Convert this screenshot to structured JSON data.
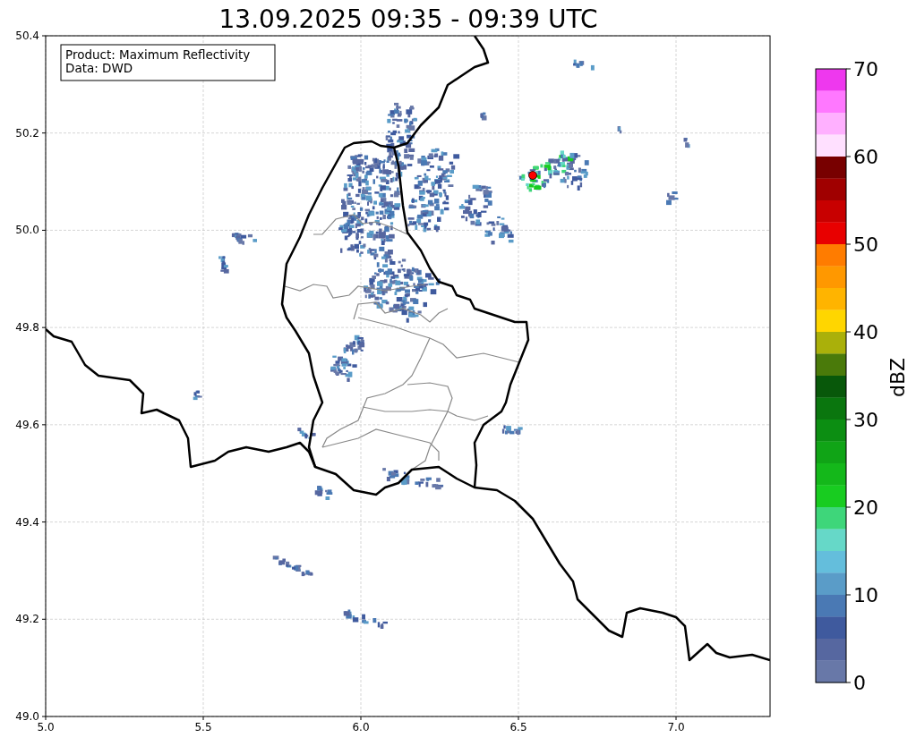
{
  "title": "13.09.2025 09:35 - 09:39 UTC",
  "info_box": [
    "Product: Maximum Reflectivity",
    "Data: DWD"
  ],
  "x_axis": {
    "ticks": [
      "5.0",
      "5.5",
      "6.0",
      "6.5",
      "7.0"
    ]
  },
  "y_axis": {
    "ticks": [
      "50.4",
      "50.2",
      "50.0",
      "49.8",
      "49.6",
      "49.4",
      "49.2",
      "49.0"
    ]
  },
  "colorbar": {
    "label": "dBZ",
    "ticks": [
      "70",
      "60",
      "50",
      "40",
      "30",
      "20",
      "10",
      "0"
    ],
    "bins": [
      {
        "color": "#ee38ee"
      },
      {
        "color": "#ff78ff"
      },
      {
        "color": "#ffb0ff"
      },
      {
        "color": "#ffe0ff"
      },
      {
        "color": "#780000"
      },
      {
        "color": "#a00000"
      },
      {
        "color": "#c80000"
      },
      {
        "color": "#e80000"
      },
      {
        "color": "#ff7c00"
      },
      {
        "color": "#ff9800"
      },
      {
        "color": "#ffb400"
      },
      {
        "color": "#ffd600"
      },
      {
        "color": "#aab00a"
      },
      {
        "color": "#4a7a0a"
      },
      {
        "color": "#08580a"
      },
      {
        "color": "#0a760e"
      },
      {
        "color": "#0c8e12"
      },
      {
        "color": "#10a416"
      },
      {
        "color": "#14b81a"
      },
      {
        "color": "#18cc20"
      },
      {
        "color": "#3ed67a"
      },
      {
        "color": "#66d8c8"
      },
      {
        "color": "#64bedc"
      },
      {
        "color": "#5a9cc8"
      },
      {
        "color": "#4a79b4"
      },
      {
        "color": "#3f5a9e"
      },
      {
        "color": "#5667a0"
      },
      {
        "color": "#6878a8"
      }
    ]
  }
}
